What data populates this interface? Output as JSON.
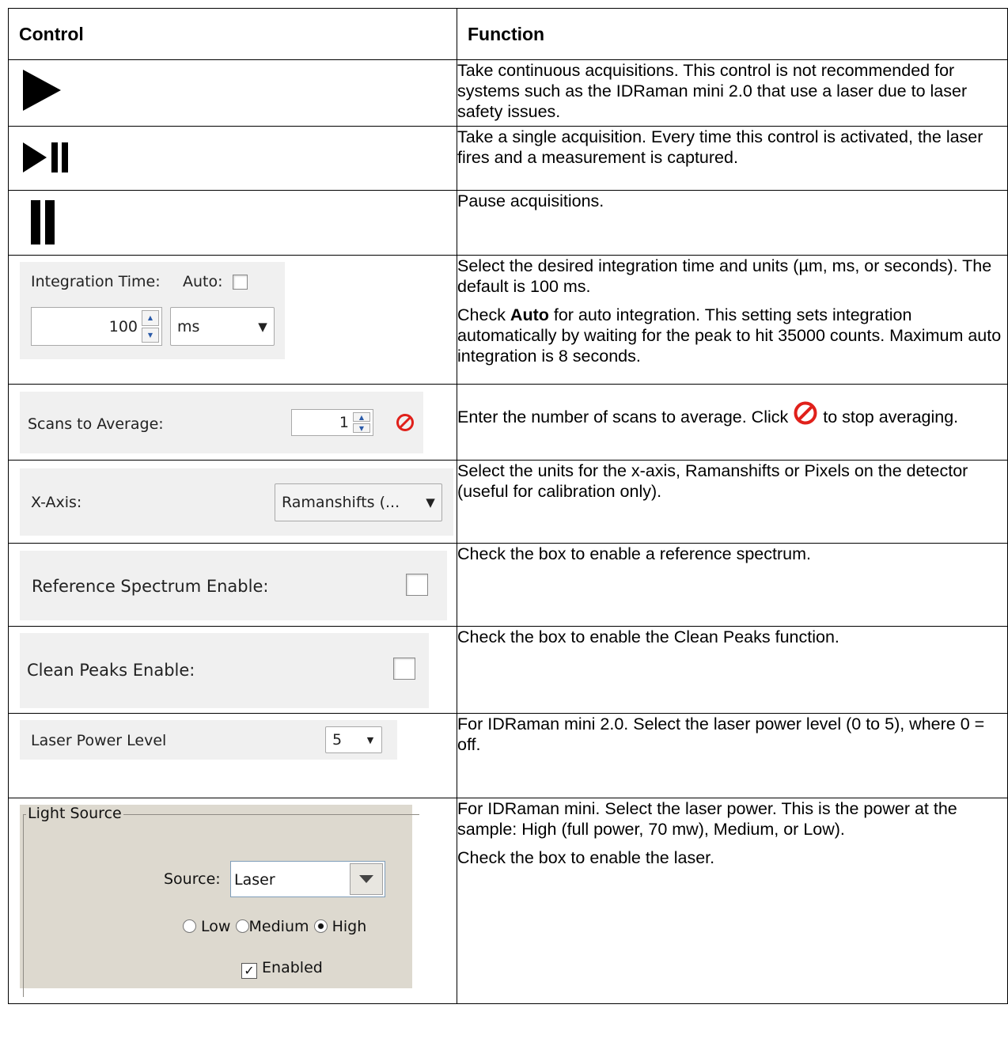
{
  "header": {
    "control": "Control",
    "function": "Function"
  },
  "rows": {
    "play": {
      "desc": "Take continuous acquisitions. This control is not recommended for systems such as the IDRaman mini 2.0 that use a laser due to laser safety issues."
    },
    "single": {
      "desc": "Take a single acquisition. Every time this control is activated, the laser fires and a measurement is captured."
    },
    "pause": {
      "desc": "Pause acquisitions."
    },
    "integration": {
      "label": "Integration Time:",
      "auto_label": "Auto:",
      "value": "100",
      "unit": "ms",
      "desc1": "Select the desired integration time and units (µm, ms, or seconds). The default is 100 ms.",
      "desc2_pre": "Check ",
      "desc2_bold": "Auto",
      "desc2_post": " for auto integration. This setting sets integration automatically by waiting for the peak to hit 35000 counts. Maximum auto integration is 8 seconds."
    },
    "scans": {
      "label": "Scans to Average:",
      "value": "1",
      "desc_pre": "Enter the number of scans to average. Click ",
      "desc_post": " to stop averaging."
    },
    "xaxis": {
      "label": "X-Axis:",
      "value": "Ramanshifts (...",
      "desc": "Select the units for the x-axis, Ramanshifts or Pixels on the detector (useful for calibration only)."
    },
    "reference": {
      "label": "Reference Spectrum Enable:",
      "desc": "Check the box to enable a reference spectrum."
    },
    "clean": {
      "label": "Clean Peaks Enable:",
      "desc": "Check the box to enable the Clean Peaks function."
    },
    "laser_level": {
      "label": "Laser Power Level",
      "value": "5",
      "desc": "For IDRaman mini 2.0. Select the laser power level (0 to 5), where 0 = off."
    },
    "light": {
      "group": "Light Source",
      "source_label": "Source:",
      "source_value": "Laser",
      "low": "Low",
      "medium": "Medium",
      "high": "High",
      "enabled": "Enabled",
      "desc1": "For IDRaman mini. Select the laser power. This is the power at the sample: High (full power, 70 mw), Medium, or Low).",
      "desc2": "Check the box to enable the laser."
    }
  }
}
